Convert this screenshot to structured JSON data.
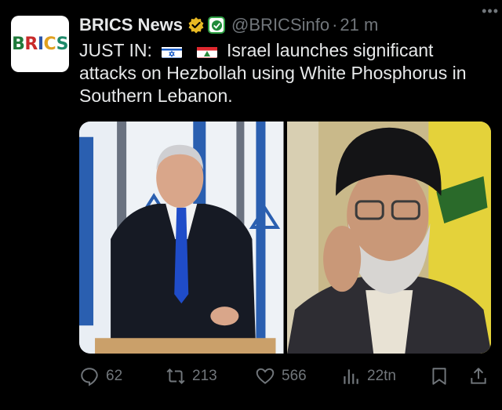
{
  "post": {
    "avatar_text": [
      "B",
      "R",
      "I",
      "C",
      "S"
    ],
    "author_name": "BRICS News",
    "handle": "@BRICSinfo",
    "separator": "·",
    "time": "21 m",
    "more_label": "•••",
    "text_prefix": "JUST IN:",
    "text_body": "Israel launches significant attacks on Hezbollah using White Phosphorus in Southern Lebanon.",
    "flags": [
      "israel-flag",
      "lebanon-flag"
    ]
  },
  "media": {
    "images": [
      "netanyahu-photo",
      "nasrallah-photo"
    ]
  },
  "actions": {
    "replies": "62",
    "reposts": "213",
    "likes": "566",
    "views": "22tn"
  },
  "colors": {
    "background": "#000000",
    "text": "#e7e9ea",
    "muted": "#71767b",
    "verified_gold": "#e8b923",
    "affiliate_green": "#2ea043"
  }
}
